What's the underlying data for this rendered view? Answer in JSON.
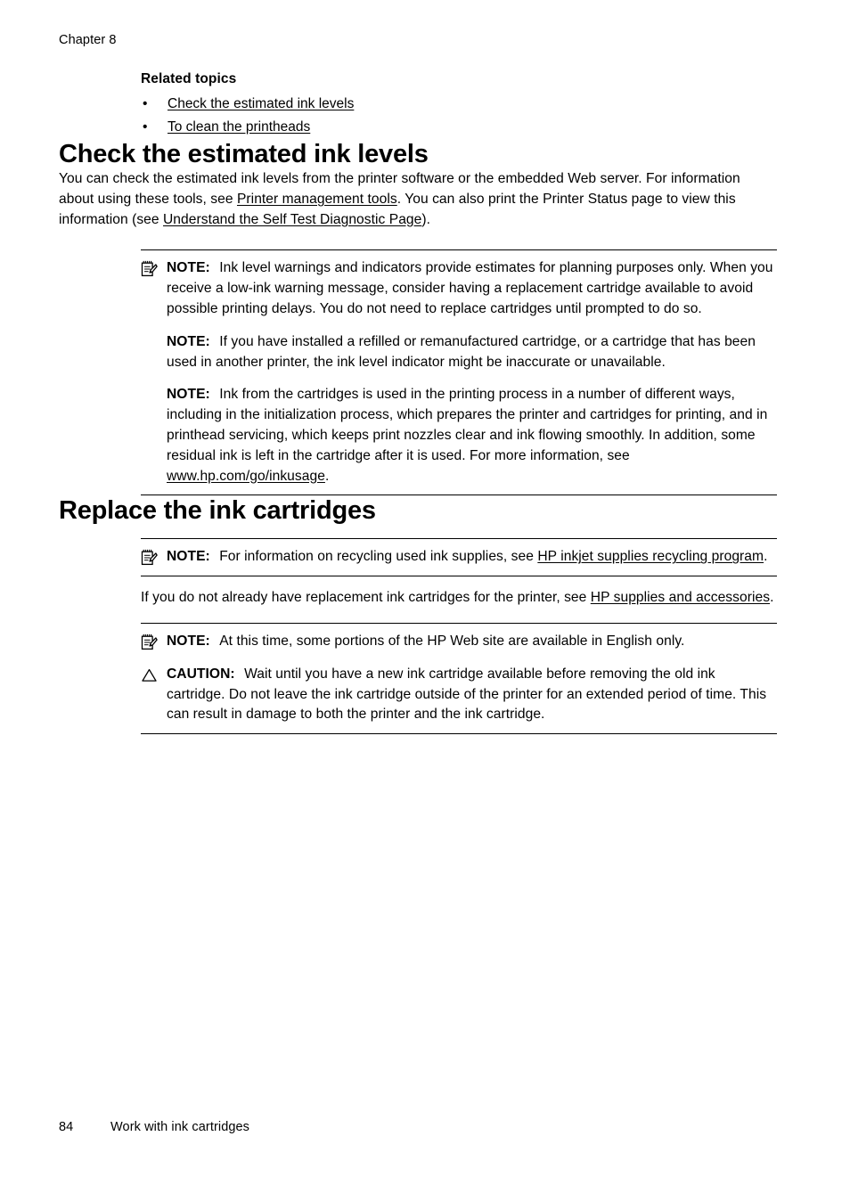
{
  "page": {
    "running_head": "Chapter 8",
    "footer_page_number": "84",
    "footer_section": "Work with ink cartridges"
  },
  "related_topics": {
    "heading": "Related topics",
    "bullet_glyph": "•",
    "items": [
      {
        "label": "Check the estimated ink levels"
      },
      {
        "label": "To clean the printheads"
      }
    ]
  },
  "sections": [
    {
      "id": "check-ink-levels",
      "title": "Check the estimated ink levels",
      "intro": {
        "part1": "You can check the estimated ink levels from the printer software or the embedded Web server. For information about using these tools, see ",
        "link1": "Printer management tools",
        "part2": ". You can also print the Printer Status page to view this information (see ",
        "link2": "Understand the Self Test Diagnostic Page",
        "part3": ")."
      },
      "notes": [
        {
          "icon": "note-icon",
          "label": "NOTE:",
          "text": "Ink level warnings and indicators provide estimates for planning purposes only. When you receive a low-ink warning message, consider having a replacement cartridge available to avoid possible printing delays. You do not need to replace cartridges until prompted to do so."
        },
        {
          "icon": "none",
          "label": "NOTE:",
          "text": "If you have installed a refilled or remanufactured cartridge, or a cartridge that has been used in another printer, the ink level indicator might be inaccurate or unavailable."
        },
        {
          "icon": "none",
          "label": "NOTE:",
          "text_part1": "Ink from the cartridges is used in the printing process in a number of different ways, including in the initialization process, which prepares the printer and cartridges for printing, and in printhead servicing, which keeps print nozzles clear and ink flowing smoothly. In addition, some residual ink is left in the cartridge after it is used. For more information, see ",
          "link": "www.hp.com/go/inkusage",
          "text_part2": "."
        }
      ]
    },
    {
      "id": "replace-ink-cartridges",
      "title": "Replace the ink cartridges",
      "note_recycling": {
        "icon": "note-icon",
        "label": "NOTE:",
        "text_part1": "For information on recycling used ink supplies, see ",
        "link": "HP inkjet supplies recycling program",
        "text_part2": "."
      },
      "paragraph_supplies": {
        "part1": "If you do not already have replacement ink cartridges for the printer, see ",
        "link": "HP supplies and accessories",
        "part2": "."
      },
      "note_english": {
        "icon": "note-icon",
        "label": "NOTE:",
        "text": "At this time, some portions of the HP Web site are available in English only."
      },
      "caution": {
        "icon": "caution-icon",
        "label": "CAUTION:",
        "text": "Wait until you have a new ink cartridge available before removing the old ink cartridge. Do not leave the ink cartridge outside of the printer for an extended period of time. This can result in damage to both the printer and the ink cartridge."
      }
    }
  ]
}
